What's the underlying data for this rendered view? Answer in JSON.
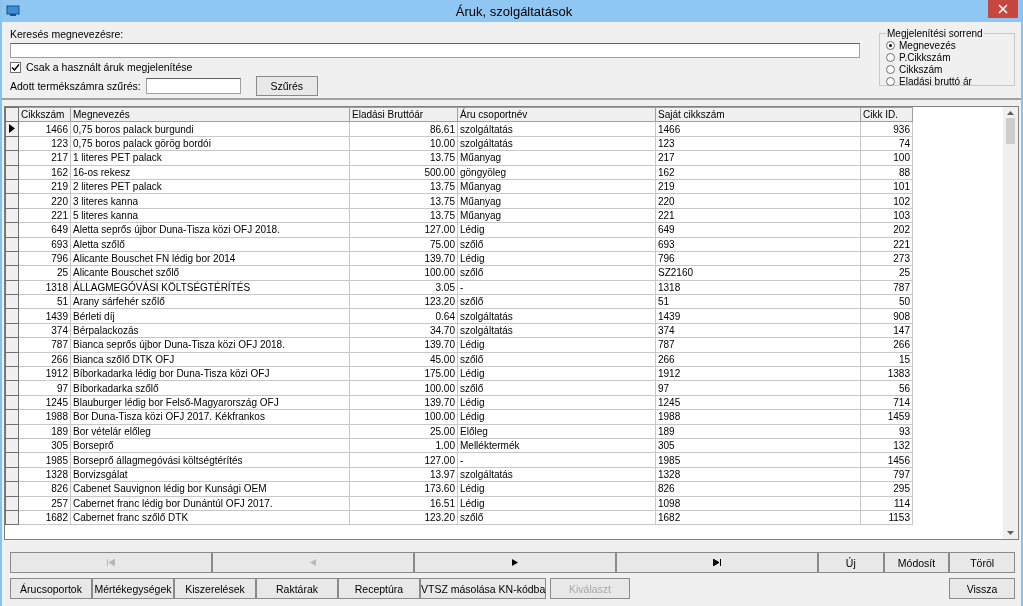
{
  "window": {
    "title": "Áruk, szolgáltatások"
  },
  "search": {
    "label": "Keresés megnevezésre:"
  },
  "used_only": {
    "label": "Csak a használt áruk megjelenítése",
    "checked": true
  },
  "product_filter": {
    "label": "Adott termékszámra szűrés:",
    "button": "Szűrés"
  },
  "sort_order": {
    "title": "Megjelenítési sorrend",
    "options": [
      {
        "label": "Megnevezés",
        "selected": true
      },
      {
        "label": "P.Cikkszám",
        "selected": false
      },
      {
        "label": "Cikkszám",
        "selected": false
      },
      {
        "label": "Eladási bruttó ár",
        "selected": false
      }
    ]
  },
  "table": {
    "columns": [
      "Cikkszám",
      "Megnevezés",
      "Eladási Bruttóár",
      "Áru csoportnév",
      "Saját cikkszám",
      "Cikk ID."
    ],
    "rows": [
      {
        "selected": true,
        "cells": [
          "1466",
          "0,75 boros palack burgundi",
          "86.61",
          "szolgáltatás",
          "1466",
          "936"
        ]
      },
      {
        "selected": false,
        "cells": [
          "123",
          "0,75 boros palack görög bordói",
          "10.00",
          "szolgáltatás",
          "123",
          "74"
        ]
      },
      {
        "selected": false,
        "cells": [
          "217",
          "1 literes PET palack",
          "13.75",
          "Műanyag",
          "217",
          "100"
        ]
      },
      {
        "selected": false,
        "cells": [
          "162",
          "16-os rekesz",
          "500.00",
          "göngyöleg",
          "162",
          "88"
        ]
      },
      {
        "selected": false,
        "cells": [
          "219",
          "2 literes PET palack",
          "13.75",
          "Műanyag",
          "219",
          "101"
        ]
      },
      {
        "selected": false,
        "cells": [
          "220",
          "3 literes kanna",
          "13.75",
          "Műanyag",
          "220",
          "102"
        ]
      },
      {
        "selected": false,
        "cells": [
          "221",
          "5 literes kanna",
          "13.75",
          "Műanyag",
          "221",
          "103"
        ]
      },
      {
        "selected": false,
        "cells": [
          "649",
          "Aletta seprős újbor Duna-Tisza közi OFJ 2018.",
          "127.00",
          "Lédig",
          "649",
          "202"
        ]
      },
      {
        "selected": false,
        "cells": [
          "693",
          "Aletta szőlő",
          "75.00",
          "szőlő",
          "693",
          "221"
        ]
      },
      {
        "selected": false,
        "cells": [
          "796",
          "Alicante Bouschet FN lédig bor 2014",
          "139.70",
          "Lédig",
          "796",
          "273"
        ]
      },
      {
        "selected": false,
        "cells": [
          "25",
          "Alicante Bouschet szőlő",
          "100.00",
          "szőlő",
          "SZ2160",
          "25"
        ]
      },
      {
        "selected": false,
        "cells": [
          "1318",
          "ÁLLAGMEGÓVÁSI KÖLTSÉGTÉRÍTÉS",
          "3.05",
          "-",
          "1318",
          "787"
        ]
      },
      {
        "selected": false,
        "cells": [
          "51",
          "Arany sárfehér szőlő",
          "123.20",
          "szőlő",
          "51",
          "50"
        ]
      },
      {
        "selected": false,
        "cells": [
          "1439",
          "Bérleti díj",
          "0.64",
          "szolgáltatás",
          "1439",
          "908"
        ]
      },
      {
        "selected": false,
        "cells": [
          "374",
          "Bérpalackozás",
          "34.70",
          "szolgáltatás",
          "374",
          "147"
        ]
      },
      {
        "selected": false,
        "cells": [
          "787",
          "Bianca seprős újbor Duna-Tisza közi OFJ 2018.",
          "139.70",
          "Lédig",
          "787",
          "266"
        ]
      },
      {
        "selected": false,
        "cells": [
          "266",
          "Bianca szőlő DTK OFJ",
          "45.00",
          "szőlő",
          "266",
          "15"
        ]
      },
      {
        "selected": false,
        "cells": [
          "1912",
          "Bíborkadarka lédig bor Duna-Tisza közi OFJ",
          "175.00",
          "Lédig",
          "1912",
          "1383"
        ]
      },
      {
        "selected": false,
        "cells": [
          "97",
          "Bíborkadarka szőlő",
          "100.00",
          "szőlő",
          "97",
          "56"
        ]
      },
      {
        "selected": false,
        "cells": [
          "1245",
          "Blauburger lédig bor Felső-Magyarország OFJ",
          "139.70",
          "Lédig",
          "1245",
          "714"
        ]
      },
      {
        "selected": false,
        "cells": [
          "1988",
          "Bor Duna-Tisza közi OFJ 2017. Kékfrankos",
          "100.00",
          "Lédig",
          "1988",
          "1459"
        ]
      },
      {
        "selected": false,
        "cells": [
          "189",
          "Bor vételár előleg",
          "25.00",
          "Előleg",
          "189",
          "93"
        ]
      },
      {
        "selected": false,
        "cells": [
          "305",
          "Borseprő",
          "1.00",
          "Melléktermék",
          "305",
          "132"
        ]
      },
      {
        "selected": false,
        "cells": [
          "1985",
          "Borseprő állagmegóvási költségtérítés",
          "127.00",
          "-",
          "1985",
          "1456"
        ]
      },
      {
        "selected": false,
        "cells": [
          "1328",
          "Borvizsgálat",
          "13.97",
          "szolgáltatás",
          "1328",
          "797"
        ]
      },
      {
        "selected": false,
        "cells": [
          "826",
          "Cabenet Sauvignon lédig bor Kunsági OEM",
          "173.60",
          "Lédig",
          "826",
          "295"
        ]
      },
      {
        "selected": false,
        "cells": [
          "257",
          "Cabernet franc lédig bor Dunántúl OFJ 2017.",
          "16.51",
          "Lédig",
          "1098",
          "114"
        ]
      },
      {
        "selected": false,
        "cells": [
          "1682",
          "Cabernet franc szőlő DTK",
          "123.20",
          "szőlő",
          "1682",
          "1153"
        ]
      }
    ]
  },
  "navigator": [
    {
      "kind": "first",
      "disabled": true
    },
    {
      "kind": "prev",
      "disabled": true
    },
    {
      "kind": "next",
      "disabled": false
    },
    {
      "kind": "last",
      "disabled": false
    }
  ],
  "record_buttons": [
    {
      "label": "Új",
      "disabled": false
    },
    {
      "label": "Módosít",
      "disabled": false
    },
    {
      "label": "Töröl",
      "disabled": false
    }
  ],
  "bottom_buttons": [
    {
      "label": "Árucsoportok",
      "disabled": false
    },
    {
      "label": "Mértékegységek",
      "disabled": false
    },
    {
      "label": "Kiszerelések",
      "disabled": false
    },
    {
      "label": "Raktárak",
      "disabled": false
    },
    {
      "label": "Receptúra",
      "disabled": false
    },
    {
      "label": "VTSZ másolása KN-kódba",
      "disabled": false
    },
    {
      "label": "Kiválaszt",
      "disabled": true
    }
  ],
  "back_button": {
    "label": "Vissza",
    "disabled": false
  }
}
